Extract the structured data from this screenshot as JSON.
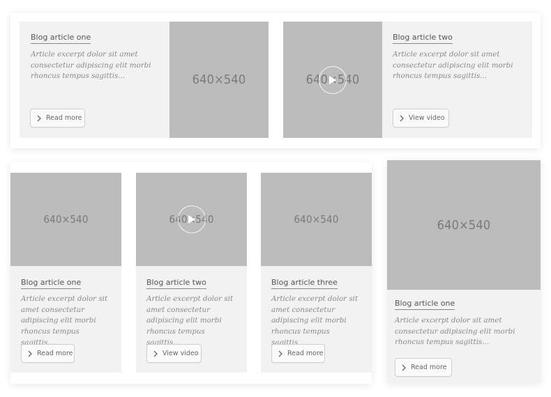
{
  "cards": {
    "top_left": {
      "title": "Blog article one",
      "excerpt": "Article excerpt dolor sit amet consectetur adipiscing elit morbi rhoncus tempus sagittis...",
      "button": "Read more",
      "image_label": "640×540"
    },
    "top_right": {
      "title": "Blog article two",
      "excerpt": "Article excerpt dolor sit amet consectetur adipiscing elit morbi rhoncus tempus sagittis...",
      "button": "View video",
      "image_label": "640×540"
    },
    "grid_one": {
      "title": "Blog article one",
      "excerpt": "Article excerpt dolor sit amet consectetur adipiscing elit morbi rhoncus tempus sagittis...",
      "button": "Read more",
      "image_label": "640×540"
    },
    "grid_two": {
      "title": "Blog article two",
      "excerpt": "Article excerpt dolor sit amet consectetur adipiscing elit morbi rhoncus tempus sagittis...",
      "button": "View video",
      "image_label": "640×540"
    },
    "grid_three": {
      "title": "Blog article three",
      "excerpt": "Article excerpt dolor sit amet consectetur adipiscing elit morbi rhoncus tempus sagittis...",
      "button": "Read more",
      "image_label": "640×540"
    },
    "single": {
      "title": "Blog article one",
      "excerpt": "Article excerpt dolor sit amet consectetur adipiscing elit morbi rhoncus tempus sagittis...",
      "button": "Read more",
      "image_label": "640×540"
    }
  },
  "icons": {
    "button": "chevron-right-icon",
    "video": "play-icon"
  },
  "colors": {
    "card_bg": "#f2f2f2",
    "placeholder_bg": "#bcbcbc",
    "placeholder_text": "#7a7a7a"
  }
}
